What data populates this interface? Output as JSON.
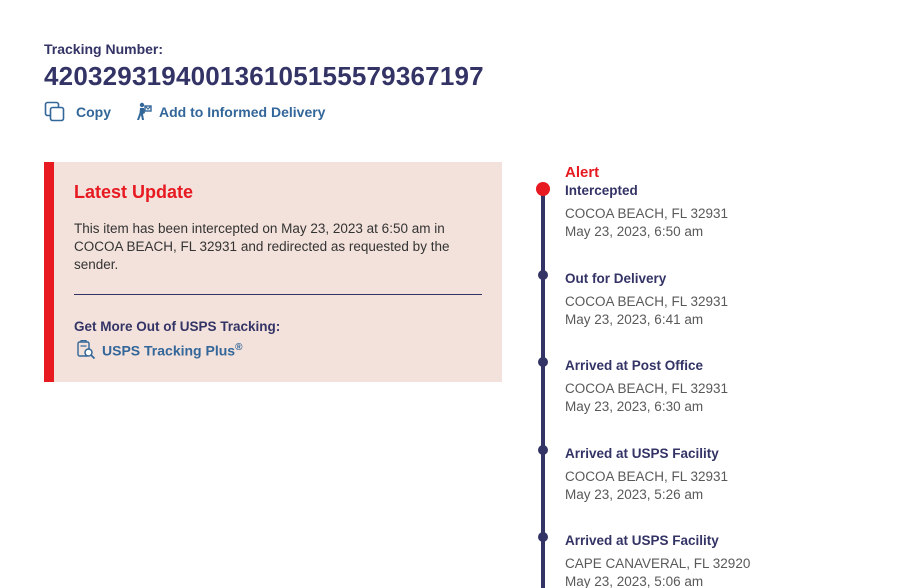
{
  "tracking": {
    "label": "Tracking Number:",
    "number": "420329319400136105155579367197"
  },
  "actions": {
    "copy_label": "Copy",
    "informed_delivery_label": "Add to Informed Delivery"
  },
  "latest_update": {
    "title": "Latest Update",
    "text": "This item has been intercepted on May 23, 2023 at 6:50 am in COCOA BEACH, FL 32931 and redirected as requested by the sender.",
    "more_title": "Get More Out of USPS Tracking:",
    "plus_label": "USPS Tracking Plus",
    "plus_mark": "®"
  },
  "timeline": {
    "alert_label": "Alert",
    "events": [
      {
        "status": "Intercepted",
        "location": "COCOA BEACH, FL 32931",
        "time": "May 23, 2023, 6:50 am"
      },
      {
        "status": "Out for Delivery",
        "location": "COCOA BEACH, FL 32931",
        "time": "May 23, 2023, 6:41 am"
      },
      {
        "status": "Arrived at Post Office",
        "location": "COCOA BEACH, FL 32931",
        "time": "May 23, 2023, 6:30 am"
      },
      {
        "status": "Arrived at USPS Facility",
        "location": "COCOA BEACH, FL 32931",
        "time": "May 23, 2023, 5:26 am"
      },
      {
        "status": "Arrived at USPS Facility",
        "location": "CAPE CANAVERAL, FL 32920",
        "time": "May 23, 2023, 5:06 am"
      }
    ]
  },
  "colors": {
    "navy": "#333366",
    "red": "#e71921",
    "link_blue": "#336699",
    "panel_bg": "#f3e2db"
  },
  "icons": {
    "copy": "copy-icon",
    "informed_delivery": "mail-carrier-icon",
    "tracking_plus": "tracking-plus-icon"
  }
}
